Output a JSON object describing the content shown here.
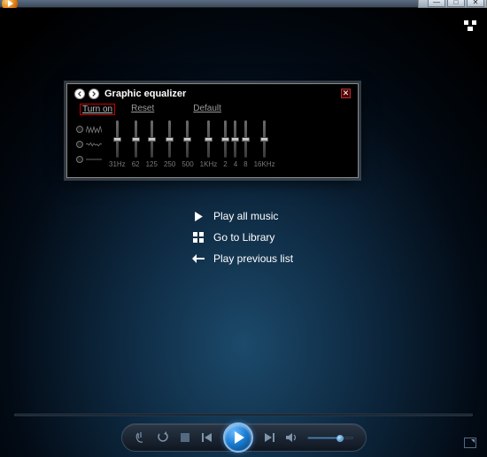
{
  "window": {
    "minimize_glyph": "—",
    "maximize_glyph": "□",
    "close_glyph": "✕"
  },
  "equalizer": {
    "title": "Graphic equalizer",
    "links": {
      "turn_on": "Turn on",
      "reset": "Reset",
      "default": "Default"
    },
    "close_glyph": "✕",
    "bands": [
      {
        "label": "31Hz",
        "pos": 0.5
      },
      {
        "label": "62",
        "pos": 0.5
      },
      {
        "label": "125",
        "pos": 0.5
      },
      {
        "label": "250",
        "pos": 0.5
      },
      {
        "label": "500",
        "pos": 0.5
      },
      {
        "label": "1KHz",
        "pos": 0.5
      },
      {
        "label": "2",
        "pos": 0.5
      },
      {
        "label": "4",
        "pos": 0.5
      },
      {
        "label": "8",
        "pos": 0.5
      },
      {
        "label": "16KHz",
        "pos": 0.5
      }
    ]
  },
  "menu": {
    "play_all": "Play all music",
    "library": "Go to Library",
    "previous": "Play previous list"
  },
  "transport": {
    "volume": 0.7
  }
}
